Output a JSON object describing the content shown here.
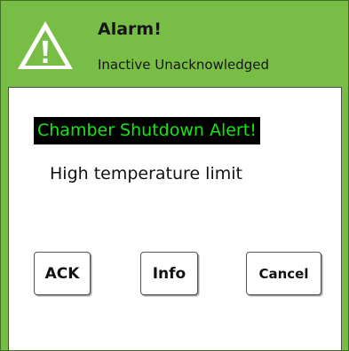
{
  "dialog": {
    "title": "Alarm!",
    "status": "Inactive Unacknowledged",
    "icon": "warning-triangle-icon",
    "colors": {
      "header_bg": "#78bd46",
      "banner_bg": "#000000",
      "banner_text": "#14e614"
    }
  },
  "alert": {
    "banner_text": "Chamber Shutdown Alert!",
    "message": "High temperature limit"
  },
  "buttons": {
    "ack": "ACK",
    "info": "Info",
    "cancel": "Cancel"
  }
}
